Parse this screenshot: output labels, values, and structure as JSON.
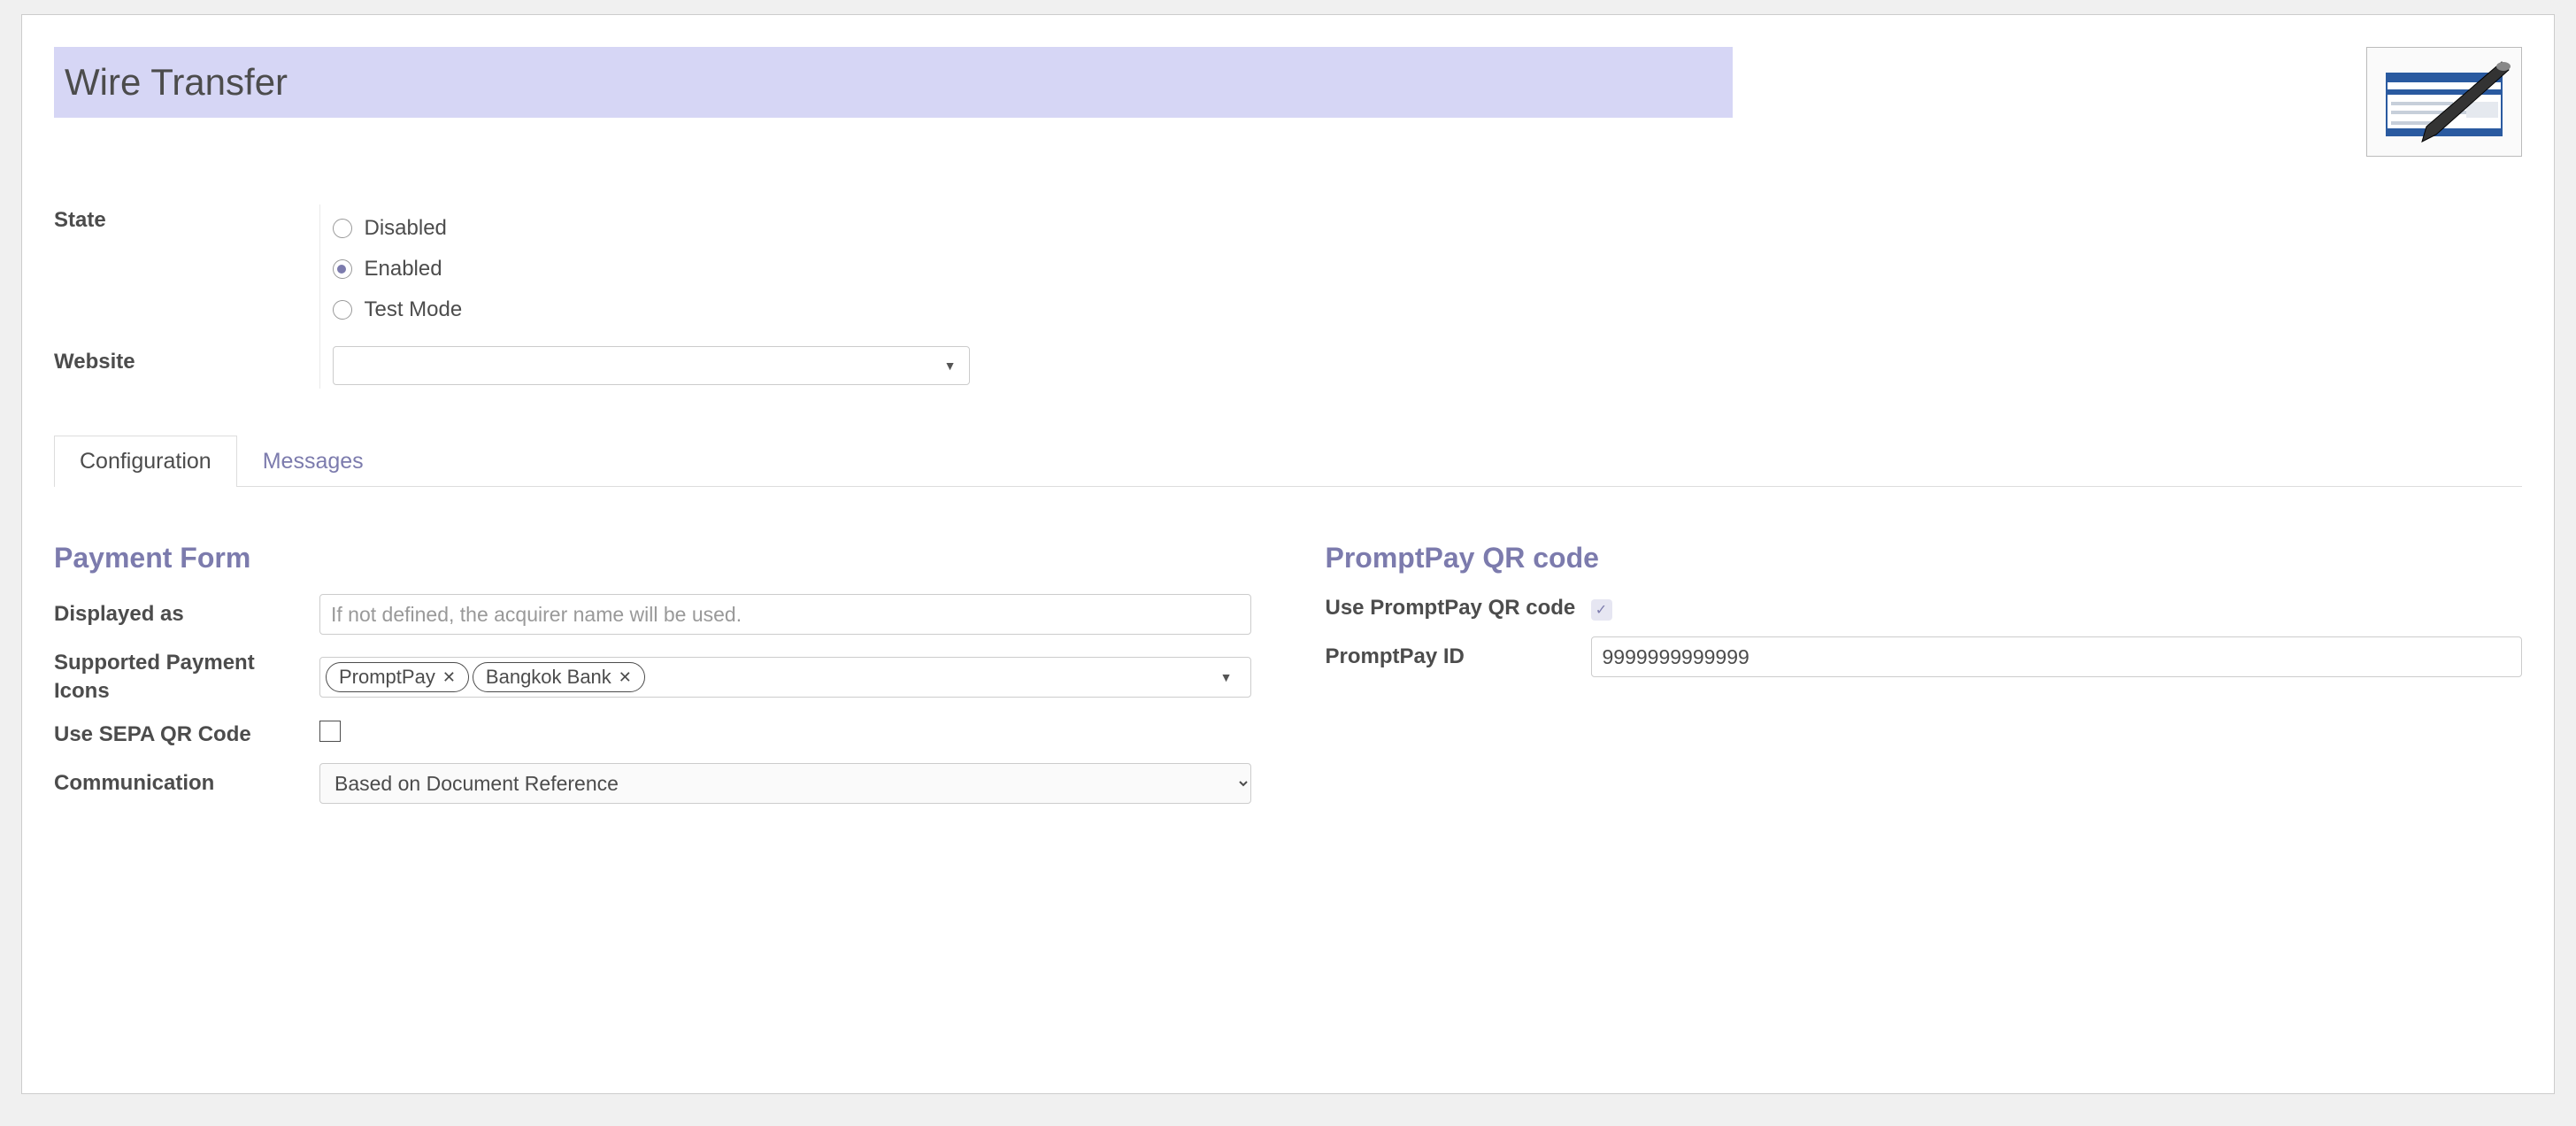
{
  "title": "Wire Transfer",
  "icon": "cheque-pen-icon",
  "fields": {
    "state_label": "State",
    "state_options": {
      "disabled": "Disabled",
      "enabled": "Enabled",
      "test": "Test Mode"
    },
    "state_value": "enabled",
    "website_label": "Website",
    "website_value": ""
  },
  "tabs": {
    "configuration": "Configuration",
    "messages": "Messages",
    "active": "configuration"
  },
  "sections": {
    "payment_form": {
      "heading": "Payment Form",
      "displayed_as_label": "Displayed as",
      "displayed_as_placeholder": "If not defined, the acquirer name will be used.",
      "displayed_as_value": "",
      "supported_icons_label": "Supported Payment Icons",
      "supported_icons_tags": [
        "PromptPay",
        "Bangkok Bank"
      ],
      "sepa_label": "Use SEPA QR Code",
      "sepa_checked": false,
      "communication_label": "Communication",
      "communication_value": "Based on Document Reference"
    },
    "promptpay": {
      "heading": "PromptPay QR code",
      "use_label": "Use PromptPay QR code",
      "use_checked": true,
      "id_label": "PromptPay ID",
      "id_value": "9999999999999"
    }
  }
}
